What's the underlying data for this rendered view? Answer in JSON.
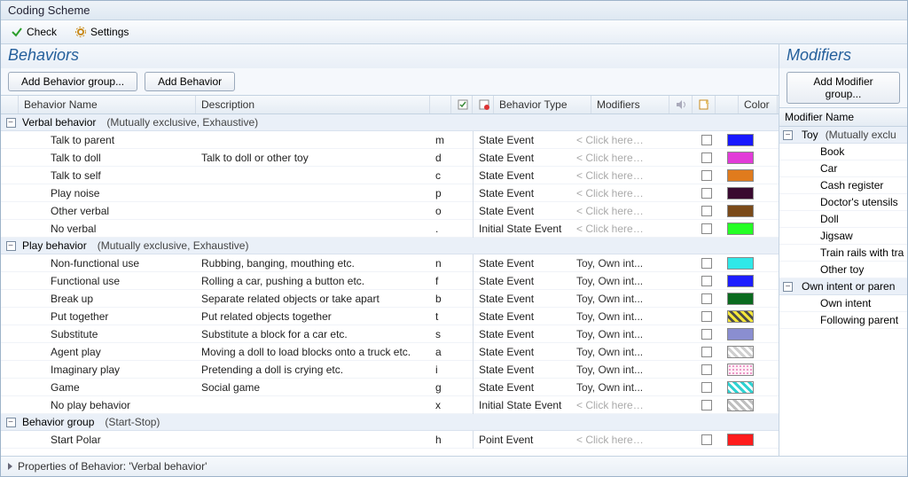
{
  "window": {
    "title": "Coding Scheme"
  },
  "toolbar": {
    "check": "Check",
    "settings": "Settings"
  },
  "panes": {
    "behaviors_title": "Behaviors",
    "modifiers_title": "Modifiers"
  },
  "buttons": {
    "add_group": "Add Behavior group...",
    "add_behavior": "Add Behavior",
    "add_modifier_group": "Add Modifier group..."
  },
  "columns": {
    "behavior_name": "Behavior Name",
    "description": "Description",
    "behavior_type": "Behavior Type",
    "modifiers": "Modifiers",
    "color": "Color",
    "modifier_name": "Modifier Name"
  },
  "placeholders": {
    "click_here": "< Click here t..."
  },
  "groups": [
    {
      "name": "Verbal behavior",
      "meta": "(Mutually exclusive, Exhaustive)",
      "expanded": true,
      "rows": [
        {
          "name": "Talk to parent",
          "desc": "",
          "key": "m",
          "type": "State Event",
          "mod": "",
          "color": "#1818ff"
        },
        {
          "name": "Talk to doll",
          "desc": "Talk to doll or other toy",
          "key": "d",
          "type": "State Event",
          "mod": "",
          "color": "#e23bd8"
        },
        {
          "name": "Talk to self",
          "desc": "",
          "key": "c",
          "type": "State Event",
          "mod": "",
          "color": "#e07b1d"
        },
        {
          "name": "Play noise",
          "desc": "",
          "key": "p",
          "type": "State Event",
          "mod": "",
          "color": "#3a0a30"
        },
        {
          "name": "Other verbal",
          "desc": "",
          "key": "o",
          "type": "State Event",
          "mod": "",
          "color": "#7a4a1a"
        },
        {
          "name": "No verbal",
          "desc": "",
          "key": ".",
          "type": "Initial State Event",
          "mod": "",
          "color": "#25ff25"
        }
      ]
    },
    {
      "name": "Play behavior",
      "meta": "(Mutually exclusive, Exhaustive)",
      "expanded": true,
      "rows": [
        {
          "name": "Non-functional use",
          "desc": "Rubbing, banging, mouthing etc.",
          "key": "n",
          "type": "State Event",
          "mod": "Toy, Own int...",
          "color": "#2fe8e8"
        },
        {
          "name": "Functional use",
          "desc": "Rolling a car, pushing a button etc.",
          "key": "f",
          "type": "State Event",
          "mod": "Toy, Own int...",
          "color": "#1d1dff"
        },
        {
          "name": "Break up",
          "desc": "Separate related objects or take apart",
          "key": "b",
          "type": "State Event",
          "mod": "Toy, Own int...",
          "color": "#0b6a1f"
        },
        {
          "name": "Put together",
          "desc": "Put related objects together",
          "key": "t",
          "type": "State Event",
          "mod": "Toy, Own int...",
          "color": "hatch:#f4e63a:#4b4b4b"
        },
        {
          "name": "Substitute",
          "desc": "Substitute a block for a car etc.",
          "key": "s",
          "type": "State Event",
          "mod": "Toy, Own int...",
          "color": "#8a8ed0"
        },
        {
          "name": "Agent play",
          "desc": "Moving a doll to load blocks onto a truck etc.",
          "key": "a",
          "type": "State Event",
          "mod": "Toy, Own int...",
          "color": "hatch:#cfcfcf:#ffffff"
        },
        {
          "name": "Imaginary play",
          "desc": "Pretending a doll is crying etc.",
          "key": "i",
          "type": "State Event",
          "mod": "Toy, Own int...",
          "color": "dots:#e87ab8:#fdf0f6"
        },
        {
          "name": "Game",
          "desc": "Social game",
          "key": "g",
          "type": "State Event",
          "mod": "Toy, Own int...",
          "color": "hatch:#2fd2d2:#ffffff"
        },
        {
          "name": "No play behavior",
          "desc": "",
          "key": "x",
          "type": "Initial State Event",
          "mod": "",
          "color": "hatch:#bfbfbf:#ffffff"
        }
      ]
    },
    {
      "name": "Behavior group",
      "meta": "(Start-Stop)",
      "expanded": true,
      "rows": [
        {
          "name": "Start Polar",
          "desc": "",
          "key": "h",
          "type": "Point Event",
          "mod": "",
          "color": "#ff1c1c"
        }
      ]
    }
  ],
  "modifier_groups": [
    {
      "name": "Toy",
      "meta": "(Mutually exclu",
      "expanded": true,
      "items": [
        "Book",
        "Car",
        "Cash register",
        "Doctor's utensils",
        "Doll",
        "Jigsaw",
        "Train rails with tra",
        "Other toy"
      ]
    },
    {
      "name": "Own intent or paren",
      "meta": "",
      "expanded": true,
      "items": [
        "Own intent",
        "Following parent"
      ]
    }
  ],
  "properties_bar": "Properties of Behavior: 'Verbal behavior'"
}
